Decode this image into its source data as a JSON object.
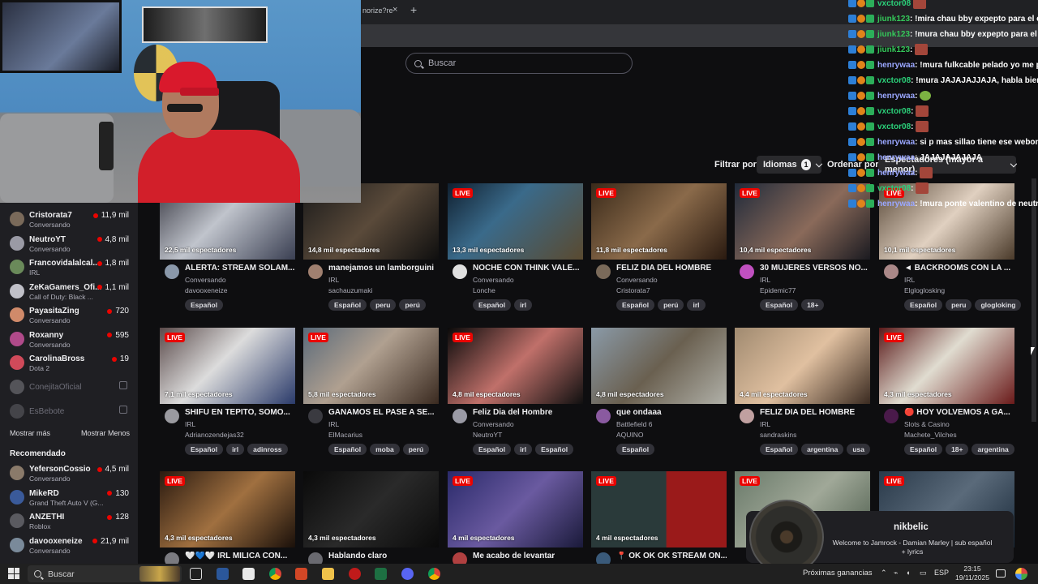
{
  "browser": {
    "tab_label": "norize?re",
    "tab_close": "×",
    "new_tab": "+"
  },
  "search": {
    "placeholder": "Buscar"
  },
  "chat": [
    {
      "user": "vxctor08",
      "msg": "",
      "color": "#2bd27a",
      "emote": true
    },
    {
      "user": "jiunk123",
      "msg": " : !mira chau bby expepto para el cab",
      "color": "#34c759",
      "emote": false
    },
    {
      "user": "jiunk123",
      "msg": " : !mura chau bby expepto para el ca",
      "color": "#34c759",
      "emote": false
    },
    {
      "user": "jiunk123",
      "msg": " : ",
      "color": "#34c759",
      "emote": true
    },
    {
      "user": "henrywaa",
      "msg": " : !mura fulkcable pelado yo me pe",
      "color": "#9aa7ff",
      "emote": false
    },
    {
      "user": "vxctor08",
      "msg": " : !mura JAJAJAJJAJA, habla bien, tú",
      "color": "#2bd27a",
      "emote": false
    },
    {
      "user": "henrywaa",
      "msg": " : ",
      "color": "#9aa7ff",
      "emote": false,
      "frog": true
    },
    {
      "user": "vxctor08",
      "msg": " : ",
      "color": "#2bd27a",
      "emote": true
    },
    {
      "user": "vxctor08",
      "msg": " : ",
      "color": "#2bd27a",
      "emote": true
    },
    {
      "user": "henrywaa",
      "msg": " : si p mas sillao tiene ese webon y",
      "color": "#9aa7ff",
      "emote": false
    },
    {
      "user": "henrywaa",
      "msg": " : JAJAJAJAJAJA",
      "color": "#9aa7ff",
      "emote": false
    },
    {
      "user": "henrywaa",
      "msg": " : ",
      "color": "#9aa7ff",
      "emote": true
    },
    {
      "user": "vxctor08",
      "msg": " : ",
      "color": "#2bd27a",
      "emote": true
    },
    {
      "user": "henrywaa",
      "msg": " : !mura ponte valentino de neutro",
      "color": "#9aa7ff",
      "emote": false
    }
  ],
  "filters": {
    "filter_label": "Filtrar por:",
    "lang_label": "Idiomas",
    "lang_count": "1",
    "sort_label": "Ordenar por:",
    "sort_value": "Espectadores (mayor a menor)"
  },
  "sidebar": {
    "followed": [
      {
        "name": "Cristorata7",
        "cat": "Conversando",
        "viewers": "11,9 mil",
        "color": "#7a6a5a"
      },
      {
        "name": "NeutroYT",
        "cat": "Conversando",
        "viewers": "4,8 mil",
        "color": "#9a9aa5"
      },
      {
        "name": "Francovidalalcal...",
        "cat": "IRL",
        "viewers": "1,8 mil",
        "color": "#6a8a5a"
      },
      {
        "name": "ZeKaGamers_Ofi...",
        "cat": "Call of Duty: Black ...",
        "viewers": "1,1 mil",
        "color": "#c0c0c8"
      },
      {
        "name": "PayasitaZing",
        "cat": "Conversando",
        "viewers": "720",
        "color": "#d08a6a"
      },
      {
        "name": "Roxanny",
        "cat": "Conversando",
        "viewers": "595",
        "color": "#b04a8a"
      },
      {
        "name": "CarolinaBross",
        "cat": "Dota 2",
        "viewers": "19",
        "color": "#d04a5a"
      }
    ],
    "offline": [
      {
        "name": "ConejitaOficial",
        "color": "#8a8a90"
      },
      {
        "name": "EsBebote",
        "color": "#6a6a70"
      }
    ],
    "more_label": "Mostrar más",
    "less_label": "Mostrar Menos",
    "section_label": "Recomendado",
    "recommended": [
      {
        "name": "YefersonCossio",
        "cat": "Conversando",
        "viewers": "4,5 mil",
        "color": "#8a7a6a"
      },
      {
        "name": "MikeRD",
        "cat": "Grand Theft Auto V (G...",
        "viewers": "130",
        "color": "#3a5a9a"
      },
      {
        "name": "ANZETHI",
        "cat": "Roblox",
        "viewers": "128",
        "color": "#5a5a60"
      },
      {
        "name": "davooxeneize",
        "cat": "Conversando",
        "viewers": "21,9 mil",
        "color": "#7a8a9a"
      }
    ]
  },
  "streams": [
    {
      "title": "ALERTA: STREAM SOLAM...",
      "cat": "Conversando",
      "channel": "davooxeneize",
      "viewers": "22,5 mil espectadores",
      "live": "",
      "tags": [
        "Español"
      ],
      "thumb": "linear-gradient(135deg,#3a3a44,#c0c4cc 45%,#3a3f52)",
      "avatar": "#8a98aa"
    },
    {
      "title": "manejamos un lamborguini",
      "cat": "IRL",
      "channel": "sachauzumaki",
      "viewers": "14,8 mil espectadores",
      "live": "",
      "tags": [
        "Español",
        "peru",
        "perú"
      ],
      "thumb": "linear-gradient(135deg,#1a1a1a,#5a4a3a 50%,#0f0f0f)",
      "avatar": "#a08070"
    },
    {
      "title": "NOCHE CON THINK VALE...",
      "cat": "Conversando",
      "channel": "Lonche",
      "viewers": "13,3 mil espectadores",
      "live": "LIVE",
      "tags": [
        "Español",
        "irl"
      ],
      "thumb": "linear-gradient(135deg,#102030,#3a6a8a 40%,#5a4a30)",
      "avatar": "#e0e0e0"
    },
    {
      "title": "FELIZ DIA DEL HOMBRE",
      "cat": "Conversando",
      "channel": "Cristorata7",
      "viewers": "11,8 mil espectadores",
      "live": "LIVE",
      "tags": [
        "Español",
        "perú",
        "irl"
      ],
      "thumb": "linear-gradient(135deg,#3a2a1a,#8a6a4a 50%,#2a1a10)",
      "avatar": "#7a6a5a"
    },
    {
      "title": "30 MUJERES VERSOS NO...",
      "cat": "IRL",
      "channel": "Epidemic77",
      "viewers": "10,4 mil espectadores",
      "live": "LIVE",
      "tags": [
        "Español",
        "18+"
      ],
      "thumb": "linear-gradient(135deg,#202a3a,#8a6a5a 55%,#1a1a20)",
      "avatar": "#c050c0"
    },
    {
      "title": "◄ BACKROOMS CON LA ...",
      "cat": "IRL",
      "channel": "Elgloglosking",
      "viewers": "10,1 mil espectadores",
      "live": "LIVE",
      "tags": [
        "Español",
        "peru",
        "glogloking"
      ],
      "thumb": "linear-gradient(135deg,#5a4a3a,#e0d0c0 50%,#4a3a2a)",
      "avatar": "#aa8888"
    },
    {
      "title": "SHIFU EN TEPITO, SOMO...",
      "cat": "IRL",
      "channel": "Adrianozendejas32",
      "viewers": "7,1 mil espectadores",
      "live": "LIVE",
      "tags": [
        "Español",
        "irl",
        "adinross"
      ],
      "thumb": "linear-gradient(135deg,#5a4a4a,#dcdcdc 45%,#2a3a6a)",
      "avatar": "#9a9aa0"
    },
    {
      "title": "GANAMOS EL PASE A SE...",
      "cat": "IRL",
      "channel": "ElMacarius",
      "viewers": "5,8 mil espectadores",
      "live": "LIVE",
      "tags": [
        "Español",
        "moba",
        "perú"
      ],
      "thumb": "linear-gradient(135deg,#5a6a7a,#b0a090 45%,#3a2a20)",
      "avatar": "#3a3a40"
    },
    {
      "title": "Feliz Dia del Hombre",
      "cat": "Conversando",
      "channel": "NeutroYT",
      "viewers": "4,8 mil espectadores",
      "live": "LIVE",
      "tags": [
        "Español",
        "irl",
        "Español"
      ],
      "thumb": "linear-gradient(135deg,#0a0a0a,#c0706a 50%,#101010)",
      "avatar": "#9a9aa5"
    },
    {
      "title": "que ondaaa",
      "cat": "Battlefield 6",
      "channel": "AQUINO",
      "viewers": "4,8 mil espectadores",
      "live": "",
      "tags": [
        "Español"
      ],
      "thumb": "linear-gradient(135deg,#8a9aa8,#6a6050 50%,#b0b0a8)",
      "avatar": "#8a5aa0"
    },
    {
      "title": "FELIZ DIA DEL HOMBRE",
      "cat": "IRL",
      "channel": "sandraskins",
      "viewers": "4,4 mil espectadores",
      "live": "",
      "tags": [
        "Español",
        "argentina",
        "usa"
      ],
      "thumb": "linear-gradient(135deg,#a08a70,#e0c0a0 50%,#3a2a20)",
      "avatar": "#c0a0a0"
    },
    {
      "title": "🔴 HOY VOLVEMOS A GA...",
      "cat": "Slots & Casino",
      "channel": "Machete_Vilches",
      "viewers": "4,3 mil espectadores",
      "live": "LIVE",
      "tags": [
        "Español",
        "18+",
        "argentina"
      ],
      "thumb": "linear-gradient(135deg,#5a1a1a,#e0dcd0 45%,#6a1a1a)",
      "avatar": "#4a1a4a"
    },
    {
      "title": "🤍💙🤍 IRL MILICA CON...",
      "cat": "",
      "channel": "",
      "viewers": "4,3 mil espectadores",
      "live": "LIVE",
      "tags": [],
      "thumb": "linear-gradient(135deg,#2a1a10,#a07040 50%,#1a100a)",
      "avatar": "#7a7a80"
    },
    {
      "title": "Hablando claro",
      "cat": "",
      "channel": "",
      "viewers": "4,3 mil espectadores",
      "live": "",
      "tags": [],
      "thumb": "linear-gradient(135deg,#0a0a0a,#2a2a2a 50%,#0a0a0a)",
      "avatar": "#6a6a70"
    },
    {
      "title": "Me acabo de levantar",
      "cat": "",
      "channel": "",
      "viewers": "4 mil espectadores",
      "live": "LIVE",
      "tags": [],
      "thumb": "linear-gradient(135deg,#2a2a6a,#6a5aa0 50%,#1a1a3a)",
      "avatar": "#b04040"
    },
    {
      "title": "📍 OK OK OK STREAM ON...",
      "cat": "",
      "channel": "",
      "viewers": "4 mil espectadores",
      "live": "LIVE",
      "tags": [],
      "thumb": "linear-gradient(90deg,#2a3a3a 0 55%,#9a1a1a 56%)",
      "avatar": "#3a5a7a"
    },
    {
      "title": "",
      "cat": "",
      "channel": "",
      "viewers": "",
      "live": "LIVE",
      "tags": [],
      "thumb": "linear-gradient(135deg,#6a7a6a,#a0a898 50%,#4a5a4a)",
      "avatar": "#6a6a70"
    },
    {
      "title": "",
      "cat": "",
      "channel": "",
      "viewers": "",
      "live": "LIVE",
      "tags": [],
      "thumb": "linear-gradient(135deg,#2a3a4a,#5a6a7a 50%,#1a2a3a)",
      "avatar": "#6a6a70"
    }
  ],
  "notification": {
    "user": "nikbelic",
    "text": "Welcome to Jamrock - Damian Marley | sub español + lyrics"
  },
  "taskbar": {
    "search": "Buscar",
    "weather": "Próximas ganancias",
    "lang": "ESP",
    "time": "23:15",
    "date": "19/11/2025"
  }
}
